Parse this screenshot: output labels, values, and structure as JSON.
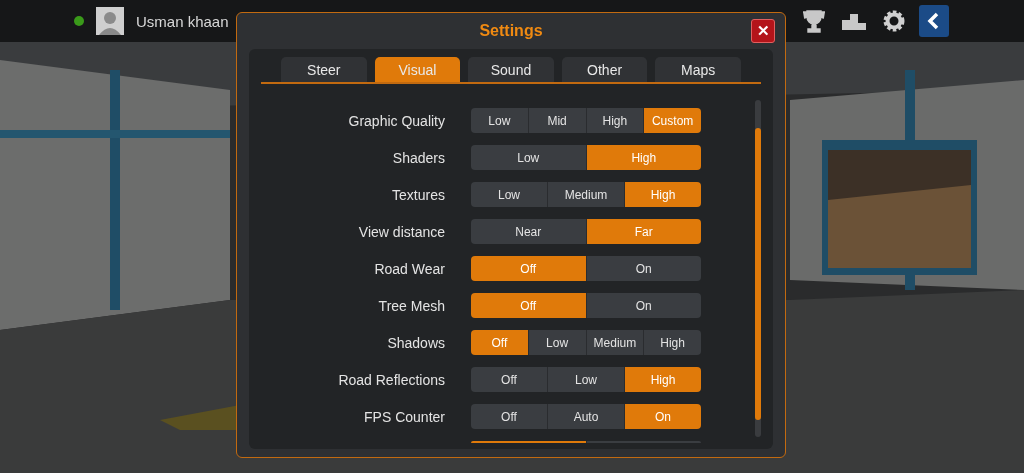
{
  "top_bar": {
    "online": true,
    "user_name": "Usman khaan"
  },
  "dialog": {
    "title": "Settings",
    "close": "✕",
    "tabs": [
      {
        "label": "Steer",
        "selected": false
      },
      {
        "label": "Visual",
        "selected": true
      },
      {
        "label": "Sound",
        "selected": false
      },
      {
        "label": "Other",
        "selected": false
      },
      {
        "label": "Maps",
        "selected": false
      }
    ],
    "settings": [
      {
        "label": "Graphic Quality",
        "options": [
          {
            "label": "Low",
            "selected": false
          },
          {
            "label": "Mid",
            "selected": false
          },
          {
            "label": "High",
            "selected": false
          },
          {
            "label": "Custom",
            "selected": true
          }
        ]
      },
      {
        "label": "Shaders",
        "options": [
          {
            "label": "Low",
            "selected": false
          },
          {
            "label": "High",
            "selected": true
          }
        ]
      },
      {
        "label": "Textures",
        "options": [
          {
            "label": "Low",
            "selected": false
          },
          {
            "label": "Medium",
            "selected": false
          },
          {
            "label": "High",
            "selected": true
          }
        ]
      },
      {
        "label": "View distance",
        "options": [
          {
            "label": "Near",
            "selected": false
          },
          {
            "label": "Far",
            "selected": true
          }
        ]
      },
      {
        "label": "Road Wear",
        "options": [
          {
            "label": "Off",
            "selected": true
          },
          {
            "label": "On",
            "selected": false
          }
        ]
      },
      {
        "label": "Tree Mesh",
        "options": [
          {
            "label": "Off",
            "selected": true
          },
          {
            "label": "On",
            "selected": false
          }
        ]
      },
      {
        "label": "Shadows",
        "options": [
          {
            "label": "Off",
            "selected": true
          },
          {
            "label": "Low",
            "selected": false
          },
          {
            "label": "Medium",
            "selected": false
          },
          {
            "label": "High",
            "selected": false
          }
        ]
      },
      {
        "label": "Road Reflections",
        "options": [
          {
            "label": "Off",
            "selected": false
          },
          {
            "label": "Low",
            "selected": false
          },
          {
            "label": "High",
            "selected": true
          }
        ]
      },
      {
        "label": "FPS Counter",
        "options": [
          {
            "label": "Off",
            "selected": false
          },
          {
            "label": "Auto",
            "selected": false
          },
          {
            "label": "On",
            "selected": true
          }
        ]
      }
    ],
    "partial_row": {
      "options": [
        {
          "selected": true
        },
        {
          "selected": false
        }
      ]
    }
  }
}
